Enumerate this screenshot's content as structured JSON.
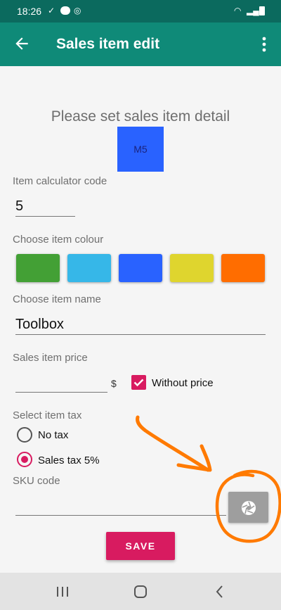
{
  "status_bar": {
    "time": "18:26",
    "icons": [
      "download-icon",
      "app-badge-icon",
      "sync-icon",
      "wifi-icon",
      "signal-icon",
      "battery-icon"
    ]
  },
  "app_bar": {
    "title": "Sales item edit",
    "back_icon": "arrow-back-icon",
    "menu_icon": "more-vert-icon"
  },
  "form": {
    "heading": "Please set sales item detail",
    "preview_label": "M5",
    "preview_color": "#2962ff",
    "calculator_code": {
      "label": "Item calculator code",
      "value": "5"
    },
    "colour": {
      "label": "Choose item colour",
      "swatches": [
        "#43a035",
        "#36b7e8",
        "#2962ff",
        "#dfd52e",
        "#ff6d00"
      ]
    },
    "name": {
      "label": "Choose item name",
      "value": "Toolbox"
    },
    "price": {
      "label": "Sales item price",
      "value": "",
      "currency": "$",
      "without_price_label": "Without price",
      "without_price_checked": true
    },
    "tax": {
      "label": "Select item tax",
      "options": [
        {
          "label": "No tax",
          "selected": false
        },
        {
          "label": "Sales tax 5%",
          "selected": true
        }
      ]
    },
    "sku": {
      "label": "SKU code",
      "value": "",
      "scan_icon": "camera-shutter-icon"
    },
    "save_label": "SAVE"
  },
  "colors": {
    "status_bar": "#0b6a5e",
    "app_bar": "#0f8a78",
    "accent": "#d81b60",
    "annotation": "#ff7a00"
  },
  "nav_bar": {
    "icons": [
      "recent-apps-icon",
      "home-icon",
      "back-icon"
    ]
  }
}
